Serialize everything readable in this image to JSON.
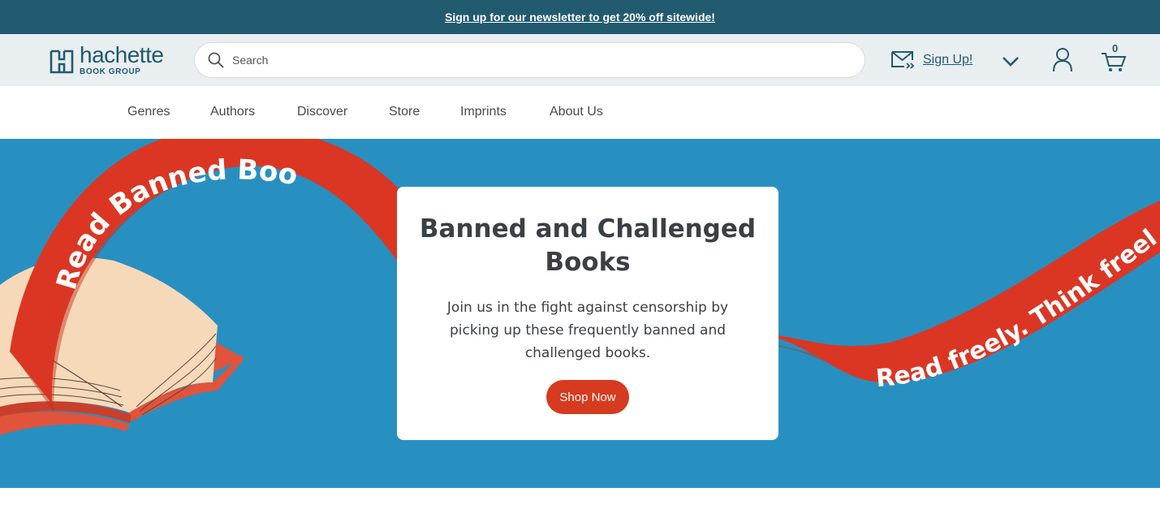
{
  "promo": {
    "text": "Sign up for our newsletter to get 20% off sitewide!"
  },
  "logo": {
    "word": "hachette",
    "sub": "BOOK GROUP"
  },
  "search": {
    "placeholder": "Search"
  },
  "header": {
    "signup_label": "Sign Up!",
    "cart_count": "0"
  },
  "nav": {
    "items": [
      "Genres",
      "Authors",
      "Discover",
      "Store",
      "Imprints",
      "About Us"
    ]
  },
  "hero": {
    "ribbon_left": "Read Banned Books",
    "ribbon_right": "Read freely. Think freely.",
    "title": "Banned and Challenged Books",
    "body": "Join us in the fight against censorship by picking up these frequently banned and challenged books.",
    "button": "Shop Now"
  },
  "colors": {
    "brand": "#225a70",
    "hero_bg": "#2890c0",
    "accent_red": "#d63a1f",
    "header_bg": "#e9eef1"
  }
}
